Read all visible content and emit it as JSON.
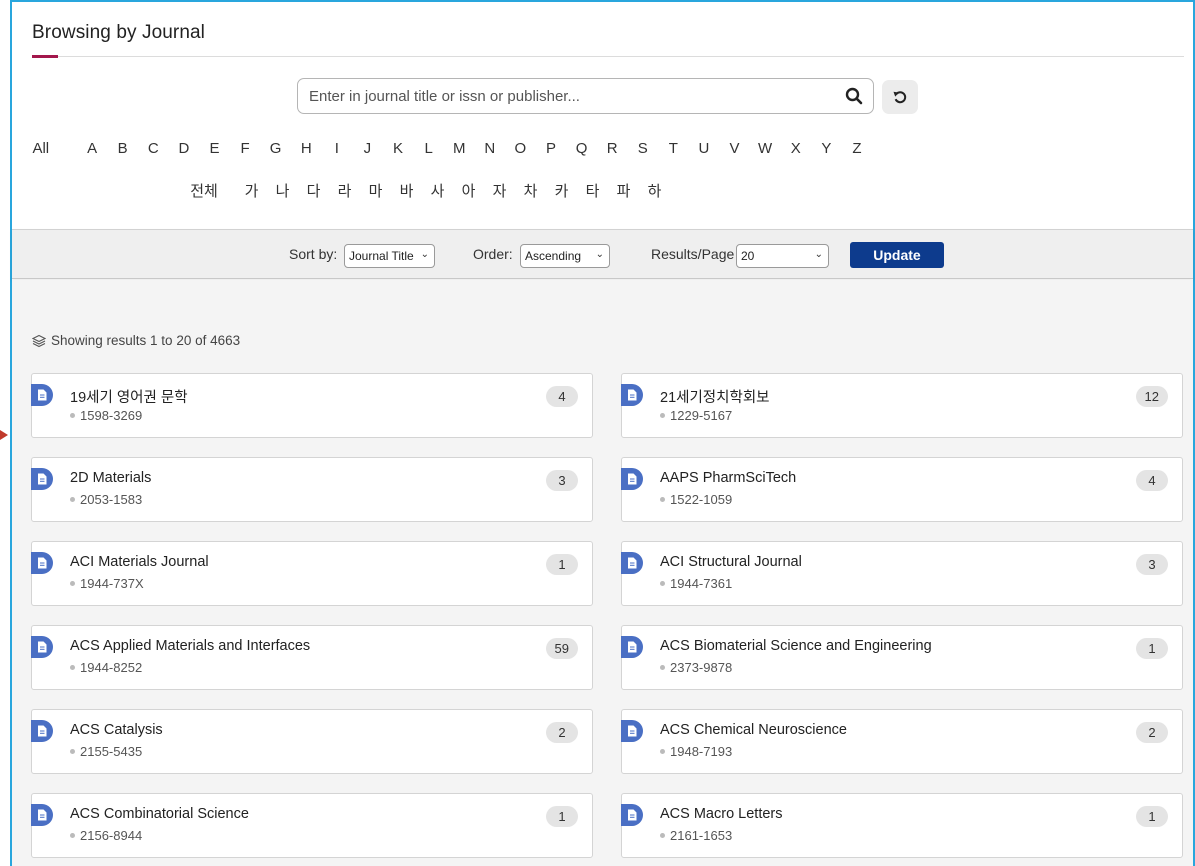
{
  "header": {
    "title": "Browsing by Journal"
  },
  "search": {
    "placeholder": "Enter in journal title or issn or publisher..."
  },
  "alphabet": {
    "all": "All",
    "letters": [
      "A",
      "B",
      "C",
      "D",
      "E",
      "F",
      "G",
      "H",
      "I",
      "J",
      "K",
      "L",
      "M",
      "N",
      "O",
      "P",
      "Q",
      "R",
      "S",
      "T",
      "U",
      "V",
      "W",
      "X",
      "Y",
      "Z"
    ],
    "korean_all": "전체",
    "korean": [
      "가",
      "나",
      "다",
      "라",
      "마",
      "바",
      "사",
      "아",
      "자",
      "차",
      "카",
      "타",
      "파",
      "하"
    ]
  },
  "toolbar": {
    "sort_label": "Sort by:",
    "sort_value": "Journal Title",
    "order_label": "Order:",
    "order_value": "Ascending",
    "rpp_label": "Results/Page",
    "rpp_value": "20",
    "update_label": "Update"
  },
  "results": {
    "showing": "Showing results 1 to 20 of 4663",
    "items": [
      {
        "title": "19세기 영어권 문학",
        "issn": "1598-3269",
        "count": "4"
      },
      {
        "title": "21세기정치학회보",
        "issn": "1229-5167",
        "count": "12"
      },
      {
        "title": "2D Materials",
        "issn": "2053-1583",
        "count": "3"
      },
      {
        "title": "AAPS PharmSciTech",
        "issn": "1522-1059",
        "count": "4"
      },
      {
        "title": "ACI Materials Journal",
        "issn": "1944-737X",
        "count": "1"
      },
      {
        "title": "ACI Structural Journal",
        "issn": "1944-7361",
        "count": "3"
      },
      {
        "title": "ACS Applied Materials and Interfaces",
        "issn": "1944-8252",
        "count": "59"
      },
      {
        "title": "ACS Biomaterial Science and Engineering",
        "issn": "2373-9878",
        "count": "1"
      },
      {
        "title": "ACS Catalysis",
        "issn": "2155-5435",
        "count": "2"
      },
      {
        "title": "ACS Chemical Neuroscience",
        "issn": "1948-7193",
        "count": "2"
      },
      {
        "title": "ACS Combinatorial Science",
        "issn": "2156-8944",
        "count": "1"
      },
      {
        "title": "ACS Macro Letters",
        "issn": "2161-1653",
        "count": "1"
      }
    ]
  }
}
